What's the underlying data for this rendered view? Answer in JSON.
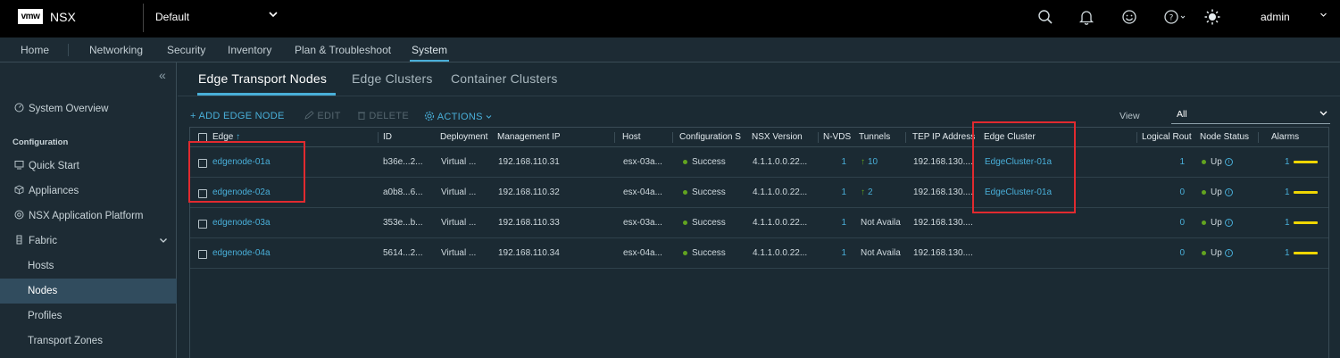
{
  "app": {
    "logo": "vmw",
    "product": "NSX",
    "project": "Default",
    "user": "admin"
  },
  "icons": {
    "search": "search-icon",
    "bell": "bell-icon",
    "smiley": "smiley-icon",
    "help": "help-icon",
    "theme": "sun-icon"
  },
  "nav": [
    "Home",
    "Networking",
    "Security",
    "Inventory",
    "Plan & Troubleshoot",
    "System"
  ],
  "sidebar": {
    "collapse": "«",
    "overview": "System Overview",
    "config_heading": "Configuration",
    "items": [
      "Quick Start",
      "Appliances",
      "NSX Application Platform",
      "Fabric"
    ],
    "fabric_children": [
      "Hosts",
      "Nodes",
      "Profiles",
      "Transport Zones"
    ]
  },
  "tabs": [
    "Edge Transport Nodes",
    "Edge Clusters",
    "Container Clusters"
  ],
  "actions": {
    "add": "+ ADD EDGE NODE",
    "edit": "EDIT",
    "delete": "DELETE",
    "actions": "ACTIONS"
  },
  "view": {
    "label": "View",
    "value": "All"
  },
  "columns": [
    "Edge",
    "ID",
    "Deployment",
    "Management IP",
    "Host",
    "Configuration S",
    "NSX Version",
    "N-VDS",
    "Tunnels",
    "TEP IP Address",
    "Edge Cluster",
    "Logical Rout",
    "Node Status",
    "Alarms"
  ],
  "rows": [
    {
      "edge": "edgenode-01a",
      "id": "b36e...2...",
      "deployment": "Virtual ...",
      "mgmt_ip": "192.168.110.31",
      "host": "esx-03a...",
      "config": "Success",
      "version": "4.1.1.0.0.22...",
      "nvds": "1",
      "tunnels": "10",
      "tep": "192.168.130....",
      "cluster": "EdgeCluster-01a",
      "routers": "1",
      "status": "Up",
      "alarms": "1"
    },
    {
      "edge": "edgenode-02a",
      "id": "a0b8...6...",
      "deployment": "Virtual ...",
      "mgmt_ip": "192.168.110.32",
      "host": "esx-04a...",
      "config": "Success",
      "version": "4.1.1.0.0.22...",
      "nvds": "1",
      "tunnels": "2",
      "tep": "192.168.130....",
      "cluster": "EdgeCluster-01a",
      "routers": "0",
      "status": "Up",
      "alarms": "1"
    },
    {
      "edge": "edgenode-03a",
      "id": "353e...b...",
      "deployment": "Virtual ...",
      "mgmt_ip": "192.168.110.33",
      "host": "esx-03a...",
      "config": "Success",
      "version": "4.1.1.0.0.22...",
      "nvds": "1",
      "tunnels": "Not Availa",
      "tep": "192.168.130....",
      "cluster": "",
      "routers": "0",
      "status": "Up",
      "alarms": "1"
    },
    {
      "edge": "edgenode-04a",
      "id": "5614...2...",
      "deployment": "Virtual ...",
      "mgmt_ip": "192.168.110.34",
      "host": "esx-04a...",
      "config": "Success",
      "version": "4.1.1.0.0.22...",
      "nvds": "1",
      "tunnels": "Not Availa",
      "tep": "192.168.130....",
      "cluster": "",
      "routers": "0",
      "status": "Up",
      "alarms": "1"
    }
  ],
  "colors": {
    "accent": "#49afd9",
    "success": "#62a420",
    "alarm": "#efd603",
    "highlight": "#e12a2f"
  }
}
